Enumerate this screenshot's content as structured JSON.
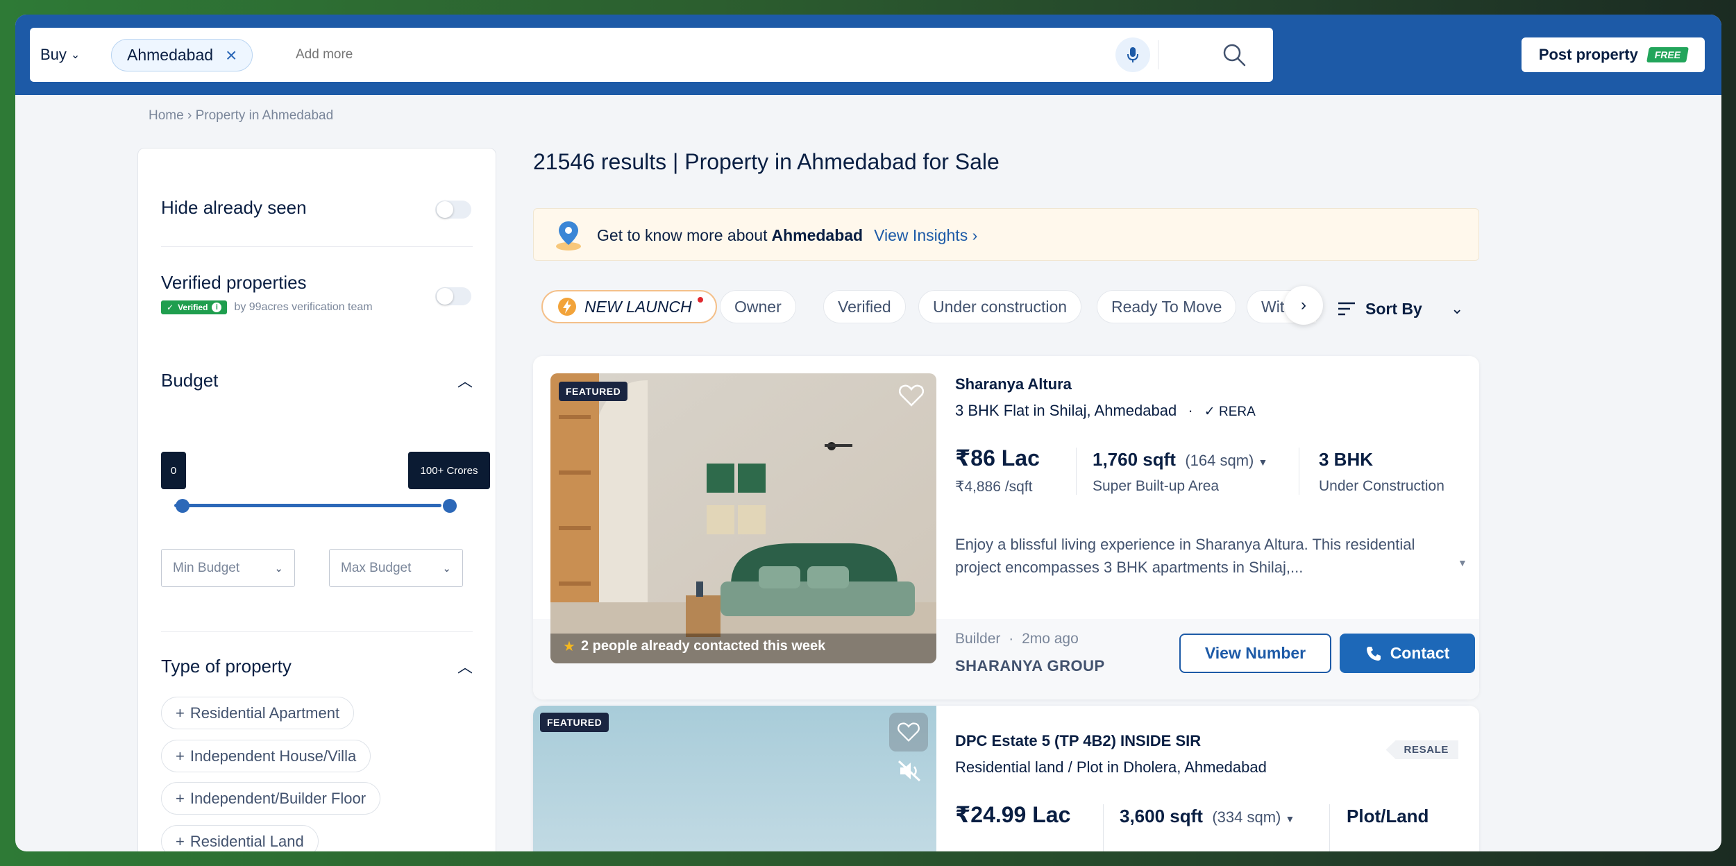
{
  "search": {
    "mode": "Buy",
    "city_chip": "Ahmedabad",
    "placeholder": "Add more"
  },
  "header": {
    "post_property": "Post property",
    "free_badge": "FREE"
  },
  "breadcrumb": "Home › Property in Ahmedabad",
  "sidebar": {
    "hide_seen": "Hide already seen",
    "verified_title": "Verified properties",
    "verified_badge": "Verified",
    "verified_by": "by 99acres verification team",
    "budget_title": "Budget",
    "budget_min_tip": "0",
    "budget_max_tip": "100+ Crores",
    "min_budget": "Min Budget",
    "max_budget": "Max Budget",
    "type_title": "Type of property",
    "types": [
      "Residential Apartment",
      "Independent House/Villa",
      "Independent/Builder Floor",
      "Residential Land"
    ]
  },
  "main": {
    "results_title": "21546 results | Property in Ahmedabad for Sale",
    "insights_prefix": "Get to know more about",
    "insights_city": "Ahmedabad",
    "insights_link": "View Insights",
    "filters": [
      "NEW LAUNCH",
      "Owner",
      "Verified",
      "Under construction",
      "Ready To Move",
      "With"
    ],
    "sort_by": "Sort By"
  },
  "listings": [
    {
      "badge": "FEATURED",
      "contacted": "2 people already contacted this week",
      "name": "Sharanya Altura",
      "subtitle_bold": "3 BHK Flat",
      "subtitle_rest": " in Shilaj, Ahmedabad",
      "rera": "RERA",
      "price": "₹86 Lac",
      "price_per": "₹4,886 /sqft",
      "area": "1,760 sqft",
      "area_sqm": "(164 sqm)",
      "area_label": "Super Built-up Area",
      "config": "3 BHK",
      "status": "Under Construction",
      "description": "Enjoy a blissful living experience in Sharanya Altura. This residential project encompasses 3 BHK apartments in Shilaj,...",
      "poster_type": "Builder",
      "posted": "2mo ago",
      "poster_name": "SHARANYA GROUP",
      "view_number": "View Number",
      "contact": "Contact"
    },
    {
      "badge": "FEATURED",
      "tag": "RESALE",
      "name": "DPC Estate 5 (TP 4B2) INSIDE SIR",
      "subtitle_bold": "Residential land / Plot",
      "subtitle_rest": " in Dholera, Ahmedabad",
      "price": "₹24.99 Lac",
      "area": "3,600 sqft",
      "area_sqm": "(334 sqm)",
      "config": "Plot/Land"
    }
  ]
}
